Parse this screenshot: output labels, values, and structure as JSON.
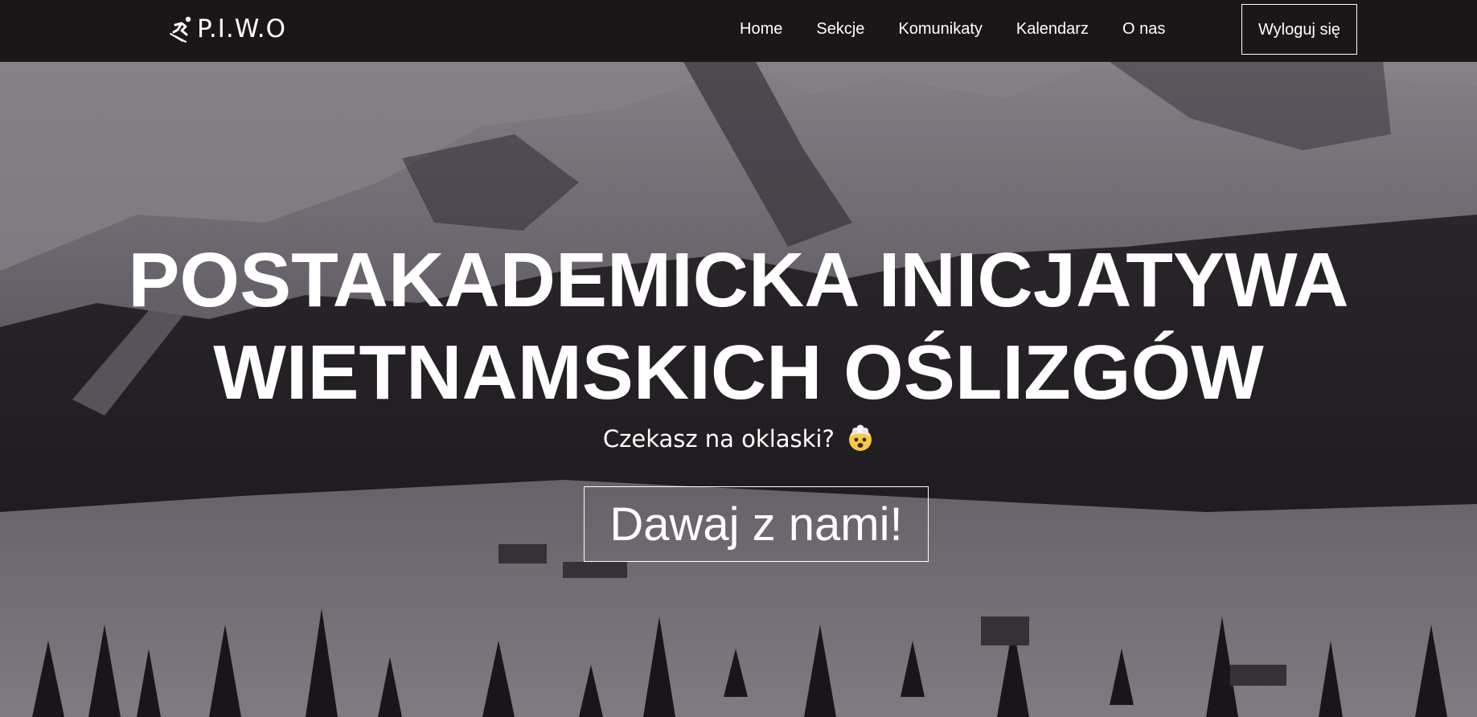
{
  "navbar": {
    "brand": "P.I.W.O",
    "brand_icon": "skier-icon",
    "links": [
      "Home",
      "Sekcje",
      "Komunikaty",
      "Kalendarz",
      "O nas"
    ],
    "logout_label": "Wyloguj się"
  },
  "hero": {
    "title_line1": "POSTAKADEMICKA INICJATYWA",
    "title_line2": "WIETNAMSKICH OŚLIZGÓW",
    "subtitle": "Czekasz na oklaski?",
    "subtitle_emoji": "exploding-head-emoji",
    "cta_label": "Dawaj z nami!",
    "background": "snowy-mountain-village-image"
  },
  "colors": {
    "navbar_bg": "#1b1718",
    "text": "#ffffff"
  }
}
